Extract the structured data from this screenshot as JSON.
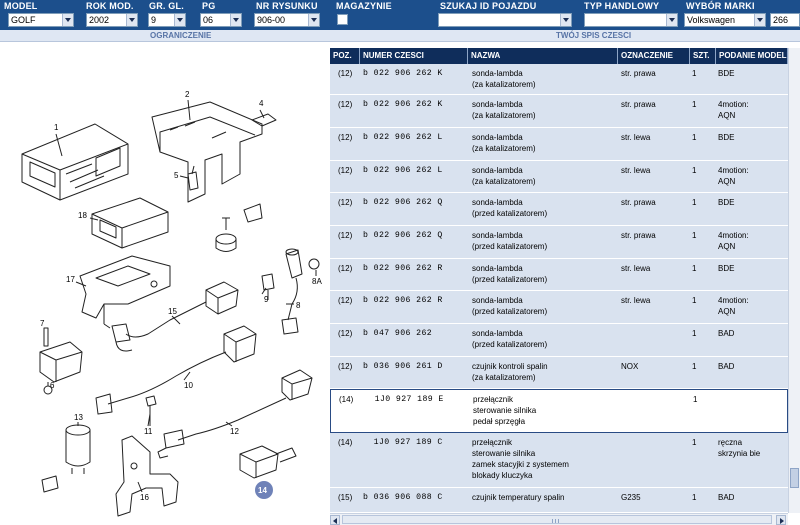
{
  "filters": {
    "model": {
      "label": "MODEL",
      "value": "GOLF"
    },
    "rok": {
      "label": "ROK MOD.",
      "value": "2002"
    },
    "gr": {
      "label": "GR. GL.",
      "value": "9"
    },
    "pg": {
      "label": "PG",
      "value": "06"
    },
    "rys": {
      "label": "NR RYSUNKU",
      "value": "906-00"
    },
    "mag": {
      "label": "MAGAZYNIE"
    },
    "szukaj": {
      "label": "SZUKAJ ID POJAZDU",
      "value": ""
    },
    "typ": {
      "label": "TYP HANDLOWY",
      "value": ""
    },
    "marka": {
      "label": "WYBÓR MARKI",
      "value": "Volkswagen"
    },
    "num": "266"
  },
  "sections": {
    "left": "OGRANICZENIE",
    "right": "TWÓJ SPIS CZESCI"
  },
  "columns": [
    "POZ.",
    "NUMER CZESCI",
    "NAZWA",
    "OZNACZENIE",
    "SZT.",
    "PODANIE MODELU"
  ],
  "rows": [
    {
      "poz": "(12)",
      "num": "b 022 906 262 K",
      "naz": "sonda-lambda\n(za katalizatorem)",
      "ozn": "str. prawa",
      "szt": "1",
      "pod": "BDE"
    },
    {
      "poz": "(12)",
      "num": "b 022 906 262 K",
      "naz": "sonda-lambda\n(za katalizatorem)",
      "ozn": "str. prawa",
      "szt": "1",
      "pod": "4motion:\nAQN"
    },
    {
      "poz": "(12)",
      "num": "b 022 906 262 L",
      "naz": "sonda-lambda\n(za katalizatorem)",
      "ozn": "str. lewa",
      "szt": "1",
      "pod": "BDE"
    },
    {
      "poz": "(12)",
      "num": "b 022 906 262 L",
      "naz": "sonda-lambda\n(za katalizatorem)",
      "ozn": "str. lewa",
      "szt": "1",
      "pod": "4motion:\nAQN"
    },
    {
      "poz": "(12)",
      "num": "b 022 906 262 Q",
      "naz": "sonda-lambda\n(przed katalizatorem)",
      "ozn": "str. prawa",
      "szt": "1",
      "pod": "BDE"
    },
    {
      "poz": "(12)",
      "num": "b 022 906 262 Q",
      "naz": "sonda-lambda\n(przed katalizatorem)",
      "ozn": "str. prawa",
      "szt": "1",
      "pod": "4motion:\nAQN"
    },
    {
      "poz": "(12)",
      "num": "b 022 906 262 R",
      "naz": "sonda-lambda\n(przed katalizatorem)",
      "ozn": "str. lewa",
      "szt": "1",
      "pod": "BDE"
    },
    {
      "poz": "(12)",
      "num": "b 022 906 262 R",
      "naz": "sonda-lambda\n(przed katalizatorem)",
      "ozn": "str. lewa",
      "szt": "1",
      "pod": "4motion:\nAQN"
    },
    {
      "poz": "(12)",
      "num": "b 047 906 262",
      "naz": "sonda-lambda\n(przed katalizatorem)",
      "ozn": "",
      "szt": "1",
      "pod": "BAD"
    },
    {
      "poz": "(12)",
      "num": "b 036 906 261 D",
      "naz": "czujnik kontroli spalin\n(za katalizatorem)",
      "ozn": "NOX",
      "szt": "1",
      "pod": "BAD"
    },
    {
      "poz": "(14)",
      "num": "  1J0 927 189 E",
      "naz": "przełącznik\nsterowanie silnika\npedał sprzęgła",
      "ozn": "",
      "szt": "1",
      "pod": ""
    },
    {
      "poz": "(14)",
      "num": "  1J0 927 189 C",
      "naz": "przełącznik\nsterowanie silnika\nzamek stacyjki z systemem\nblokady kluczyka",
      "ozn": "",
      "szt": "1",
      "pod": "ręczna\nskrzynia bie"
    },
    {
      "poz": "(15)",
      "num": "b 036 906 088 C",
      "naz": "czujnik temperatury spalin",
      "ozn": "G235",
      "szt": "1",
      "pod": "BAD"
    }
  ],
  "diagram_labels": [
    "1",
    "2",
    "4",
    "5",
    "18",
    "17",
    "9",
    "8",
    "8A",
    "7",
    "15",
    "6",
    "10",
    "11",
    "12",
    "13",
    "16",
    "14"
  ],
  "colors": {
    "header": "#1c4f8c",
    "table_head": "#0f2d5b",
    "row": "#d9e2ef",
    "accent": "#294b84"
  }
}
